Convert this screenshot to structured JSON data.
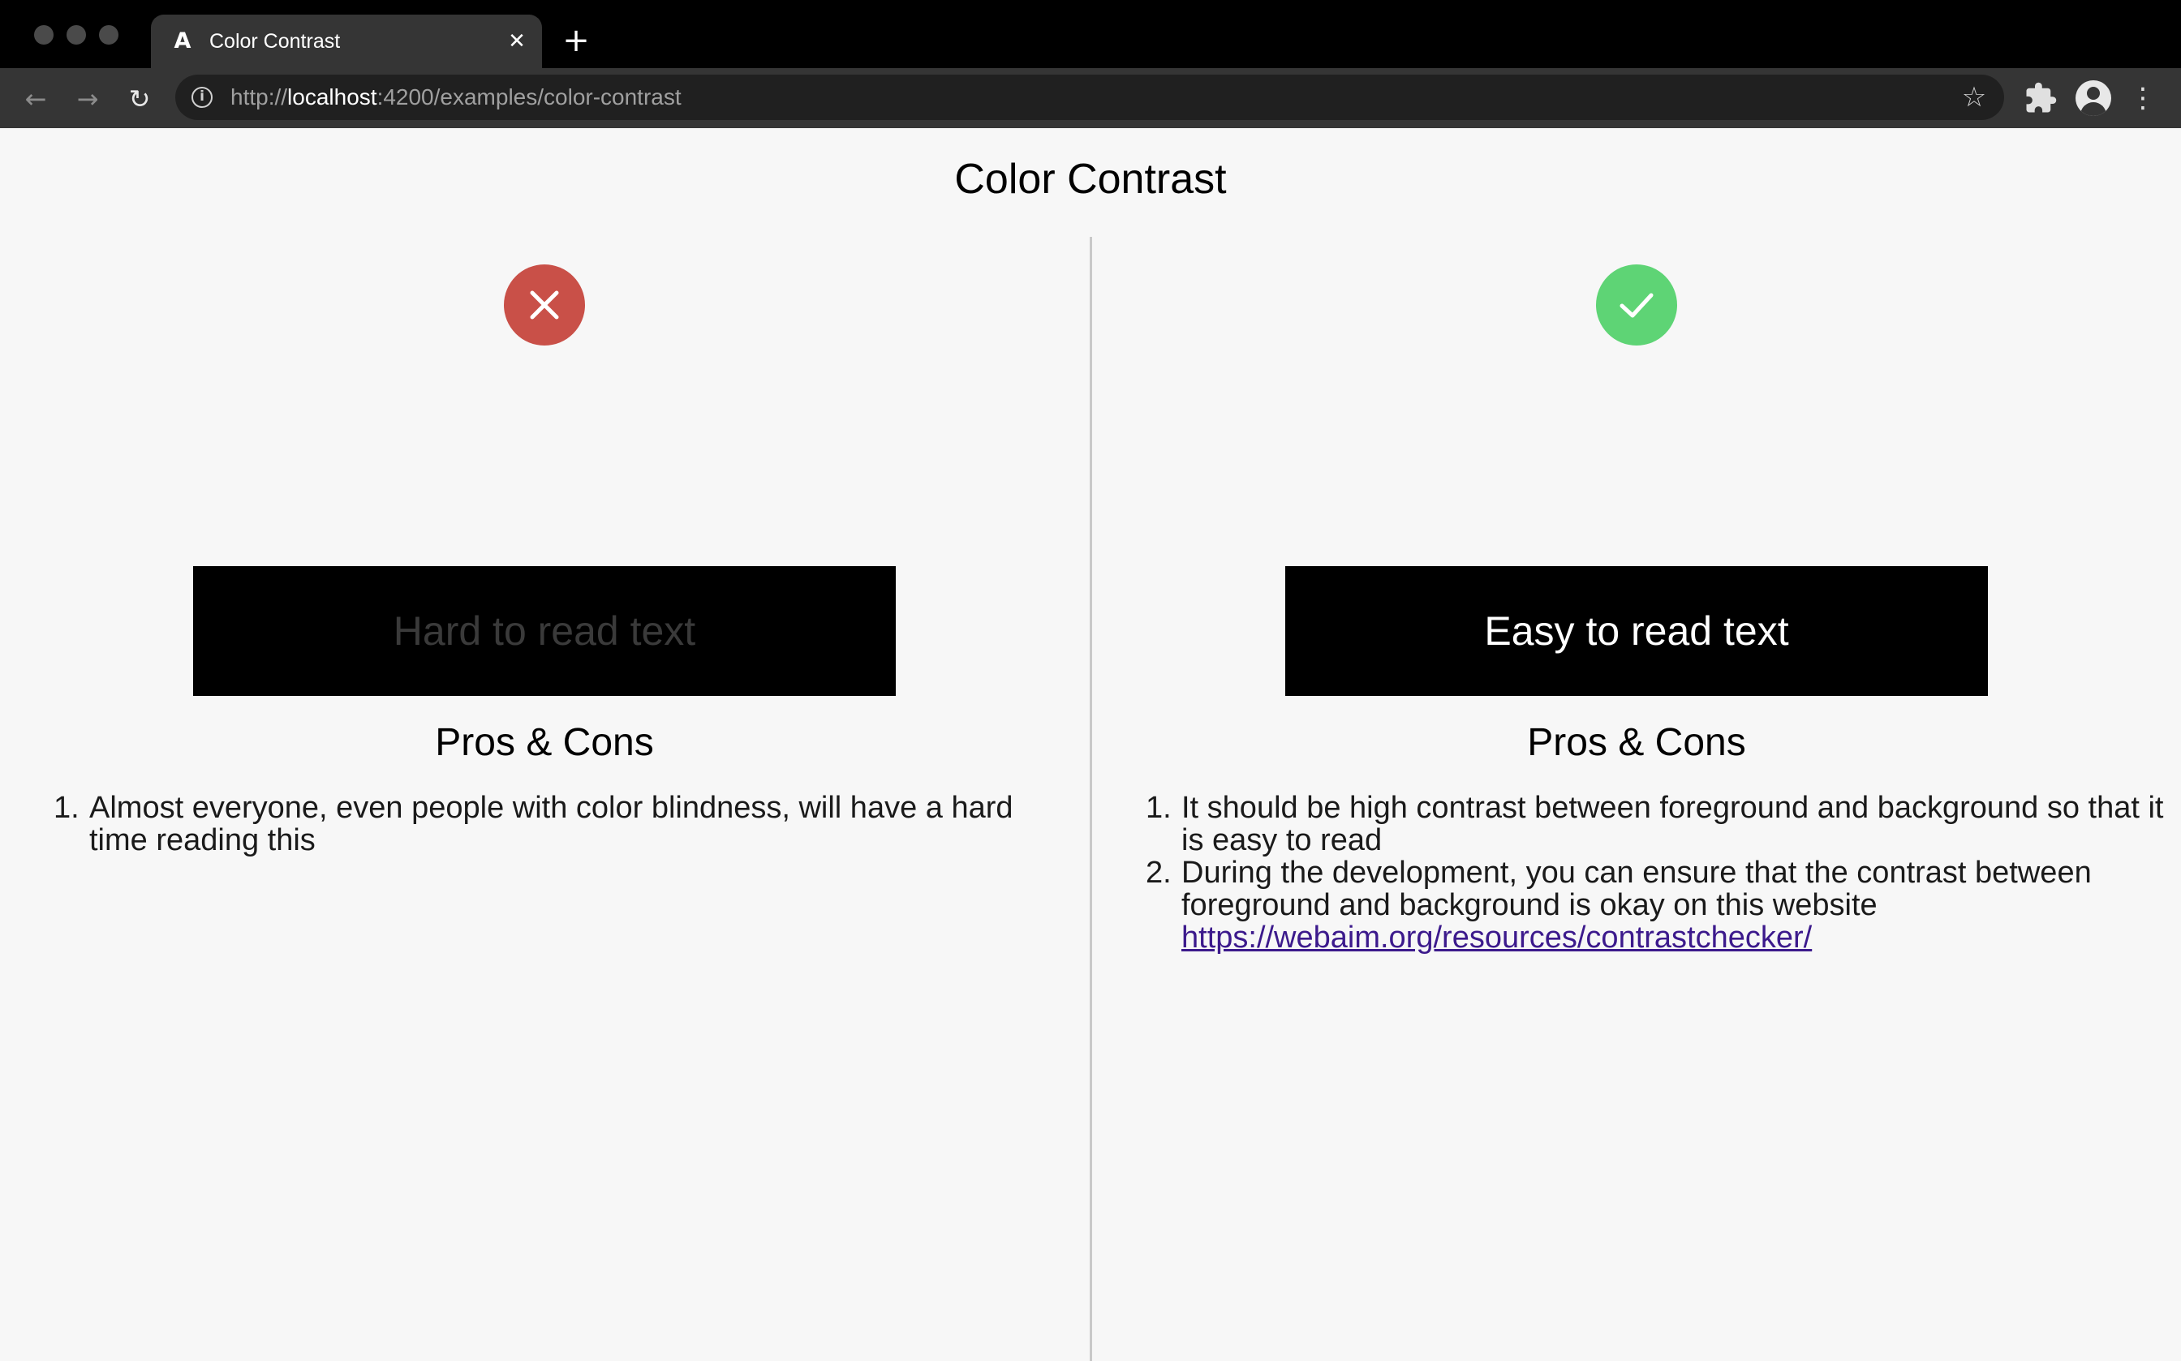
{
  "browser": {
    "tab_title": "Color Contrast",
    "tab_favicon": "angular-logo-icon",
    "new_tab": "+",
    "url_scheme": "http://",
    "url_host": "localhost",
    "url_path": ":4200/examples/color-contrast"
  },
  "page": {
    "title": "Color Contrast",
    "bad": {
      "status_icon": "close-icon",
      "status_color": "#c95048",
      "demo_text": "Hard to read text",
      "demo_text_color": "#3a3a3a",
      "section_title": "Pros & Cons",
      "points": [
        {
          "num": "1.",
          "text": "Almost everyone, even people with color blindness, will have a hard time reading this"
        }
      ]
    },
    "good": {
      "status_icon": "check-icon",
      "status_color": "#5ed475",
      "demo_text": "Easy to read text",
      "demo_text_color": "#ffffff",
      "section_title": "Pros & Cons",
      "points": [
        {
          "num": "1.",
          "text": "It should be high contrast between foreground and background so that it is easy to read"
        },
        {
          "num": "2.",
          "text": "During the development, you can ensure that the contrast between foreground and background is okay on this website",
          "link": "https://webaim.org/resources/contrastchecker/"
        }
      ]
    }
  }
}
